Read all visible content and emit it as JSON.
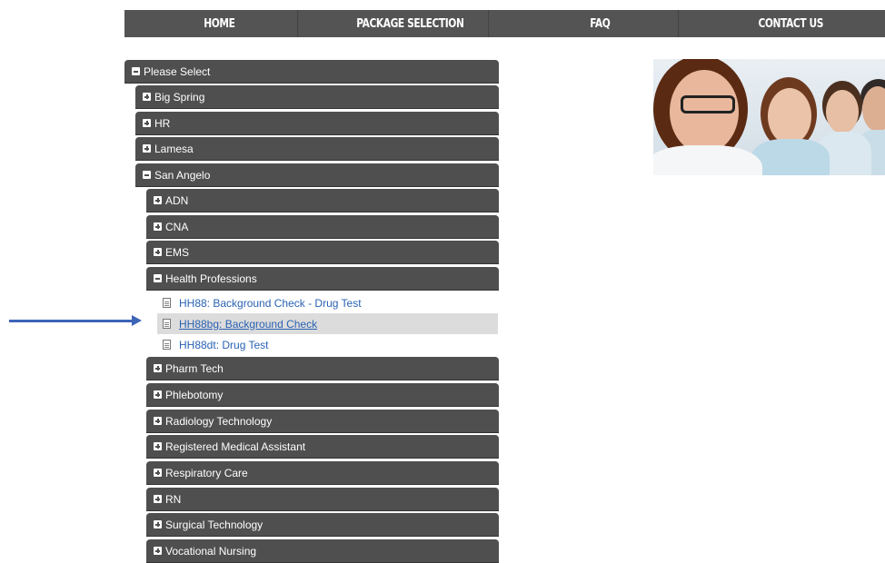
{
  "nav": {
    "items": [
      {
        "label": "HOME"
      },
      {
        "label": "PACKAGE SELECTION"
      },
      {
        "label": "FAQ"
      },
      {
        "label": "CONTACT US"
      }
    ]
  },
  "tree": {
    "root": {
      "label": "Please Select",
      "expanded": true
    },
    "locations": [
      {
        "label": "Big Spring",
        "expanded": false
      },
      {
        "label": "HR",
        "expanded": false
      },
      {
        "label": "Lamesa",
        "expanded": false
      },
      {
        "label": "San Angelo",
        "expanded": true
      }
    ],
    "programs": [
      {
        "label": "ADN",
        "expanded": false
      },
      {
        "label": "CNA",
        "expanded": false
      },
      {
        "label": "EMS",
        "expanded": false
      },
      {
        "label": "Health Professions",
        "expanded": true
      },
      {
        "label": "Pharm Tech",
        "expanded": false
      },
      {
        "label": "Phlebotomy",
        "expanded": false
      },
      {
        "label": "Radiology Technology",
        "expanded": false
      },
      {
        "label": "Registered Medical Assistant",
        "expanded": false
      },
      {
        "label": "Respiratory Care",
        "expanded": false
      },
      {
        "label": "RN",
        "expanded": false
      },
      {
        "label": "Surgical Technology",
        "expanded": false
      },
      {
        "label": "Vocational Nursing",
        "expanded": false
      }
    ],
    "packages": [
      {
        "label": "HH88: Background Check - Drug Test",
        "selected": false
      },
      {
        "label": "HH88bg: Background Check",
        "selected": true
      },
      {
        "label": "HH88dt: Drug Test",
        "selected": false
      }
    ]
  },
  "colors": {
    "nav_bg": "#545454",
    "tree_bar": "#4f4f4f",
    "link": "#2a62b3",
    "selected_row": "#dcdcdc",
    "arrow": "#3e64b8"
  },
  "icons": {
    "expanded": "minus-square-icon",
    "collapsed": "plus-square-icon",
    "package": "document-icon",
    "pointer": "arrow-right-icon"
  }
}
